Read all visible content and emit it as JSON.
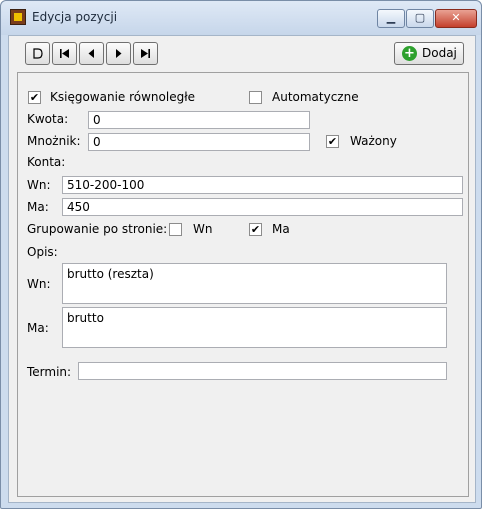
{
  "window": {
    "title": "Edycja pozycji"
  },
  "toolbar": {
    "add_label": "Dodaj"
  },
  "form": {
    "parallel_posting": {
      "label": "Księgowanie równoległe",
      "checked": true
    },
    "automatic": {
      "label": "Automatyczne",
      "checked": false
    },
    "amount": {
      "label": "Kwota:",
      "value": "0"
    },
    "multiplier": {
      "label": "Mnożnik:",
      "value": "0"
    },
    "weighted": {
      "label": "Ważony",
      "checked": true
    },
    "accounts_label": "Konta:",
    "account_wn": {
      "label": "Wn:",
      "value": "510-200-100"
    },
    "account_ma": {
      "label": "Ma:",
      "value": "450"
    },
    "grouping": {
      "label": "Grupowanie po stronie:",
      "wn": {
        "label": "Wn",
        "checked": false
      },
      "ma": {
        "label": "Ma",
        "checked": true
      }
    },
    "description_label": "Opis:",
    "desc_wn": {
      "label": "Wn:",
      "value": "brutto (reszta)"
    },
    "desc_ma": {
      "label": "Ma:",
      "value": "brutto"
    },
    "term": {
      "label": "Termin:",
      "value": ""
    }
  }
}
